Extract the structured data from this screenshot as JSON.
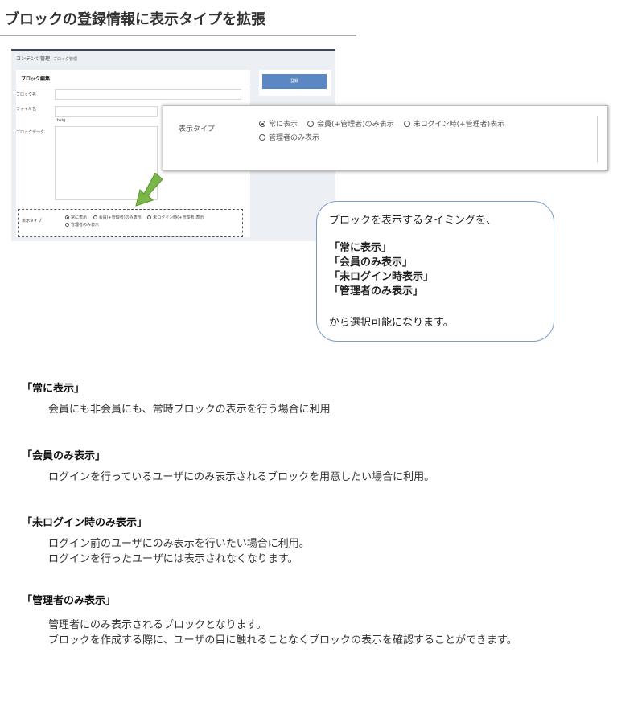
{
  "page": {
    "title": "ブロックの登録情報に表示タイプを拡張"
  },
  "screenshot": {
    "breadcrumb": "コンテンツ管理",
    "breadcrumb_sub": "ブロック管理",
    "panel_title": "ブロック編集",
    "fields": {
      "block_name": "ブロック名",
      "file_name": "ファイル名",
      "file_ext": ".twig",
      "block_data": "ブロックデータ"
    },
    "register_button": "登録",
    "display_type_label": "表示タイプ",
    "options": [
      {
        "label": "常に表示",
        "checked": true
      },
      {
        "label": "会員(+管理者)のみ表示",
        "checked": false
      },
      {
        "label": "未ログイン時(+管理者)表示",
        "checked": false
      },
      {
        "label": "管理者のみ表示",
        "checked": false
      }
    ]
  },
  "zoom": {
    "label": "表示タイプ",
    "options": [
      {
        "label": "常に表示",
        "checked": true
      },
      {
        "label": "会員(+管理者)のみ表示",
        "checked": false
      },
      {
        "label": "未ログイン時(+管理者)表示",
        "checked": false
      },
      {
        "label": "管理者のみ表示",
        "checked": false
      }
    ]
  },
  "bubble": {
    "intro": "ブロックを表示するタイミングを、",
    "items": [
      "「常に表示」",
      "「会員のみ表示」",
      "「未ログイン時表示」",
      "「管理者のみ表示」"
    ],
    "outro": "から選択可能になります。"
  },
  "descriptions": [
    {
      "heading": "「常に表示」",
      "lines": [
        "会員にも非会員にも、常時ブロックの表示を行う場合に利用"
      ]
    },
    {
      "heading": "「会員のみ表示」",
      "lines": [
        "ログインを行っているユーザにのみ表示されるブロックを用意したい場合に利用。"
      ]
    },
    {
      "heading": "「未ログイン時のみ表示」",
      "lines": [
        "ログイン前のユーザにのみ表示を行いたい場合に利用。",
        "ログインを行ったユーザには表示されなくなります。"
      ]
    },
    {
      "heading": "「管理者のみ表示」",
      "lines": [
        "管理者にのみ表示されるブロックとなります。",
        "ブロックを作成する際に、ユーザの目に触れることなくブロックの表示を確認することができます。"
      ]
    }
  ],
  "colors": {
    "accent_blue": "#5b88c2",
    "arrow_green": "#7ab648",
    "bubble_border": "#7a9cc8"
  }
}
